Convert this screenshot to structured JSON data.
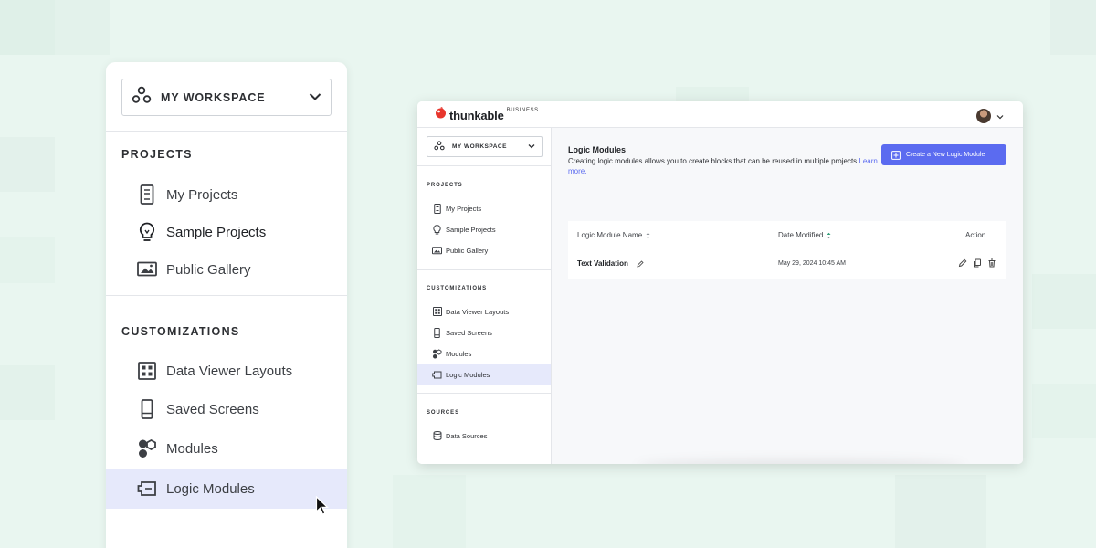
{
  "zoomed_sidebar": {
    "workspace_label": "MY WORKSPACE",
    "sections": [
      {
        "title": "PROJECTS",
        "items": [
          {
            "label": "My Projects",
            "icon": "phone-icon"
          },
          {
            "label": "Sample Projects",
            "icon": "lightbulb-icon"
          },
          {
            "label": "Public Gallery",
            "icon": "image-icon"
          }
        ]
      },
      {
        "title": "CUSTOMIZATIONS",
        "items": [
          {
            "label": "Data Viewer Layouts",
            "icon": "grid-icon"
          },
          {
            "label": "Saved Screens",
            "icon": "phone-icon"
          },
          {
            "label": "Modules",
            "icon": "modules-icon"
          },
          {
            "label": "Logic Modules",
            "icon": "logic-module-icon",
            "active": true
          }
        ]
      }
    ]
  },
  "app": {
    "brand": "thunkable",
    "brand_tier": "BUSINESS",
    "sidebar": {
      "workspace_label": "MY WORKSPACE",
      "sections": [
        {
          "title": "PROJECTS",
          "items": [
            {
              "label": "My Projects"
            },
            {
              "label": "Sample Projects"
            },
            {
              "label": "Public Gallery"
            }
          ]
        },
        {
          "title": "CUSTOMIZATIONS",
          "items": [
            {
              "label": "Data Viewer Layouts"
            },
            {
              "label": "Saved Screens"
            },
            {
              "label": "Modules"
            },
            {
              "label": "Logic Modules",
              "active": true
            }
          ]
        },
        {
          "title": "SOURCES",
          "items": [
            {
              "label": "Data Sources"
            }
          ]
        }
      ]
    },
    "main": {
      "title": "Logic Modules",
      "description": "Creating logic modules allows you to create blocks that can be reused in multiple projects.",
      "learn_more": "Learn more.",
      "create_button": "Create a New Logic Module",
      "table": {
        "columns": [
          "Logic Module Name",
          "Date Modified",
          "Action"
        ],
        "rows": [
          {
            "name": "Text Validation",
            "date": "May 29, 2024 10:45 AM"
          }
        ]
      }
    }
  },
  "colors": {
    "background": "#e9f6f0",
    "accent": "#5b6bf0",
    "active_item": "#e6e9fb"
  }
}
